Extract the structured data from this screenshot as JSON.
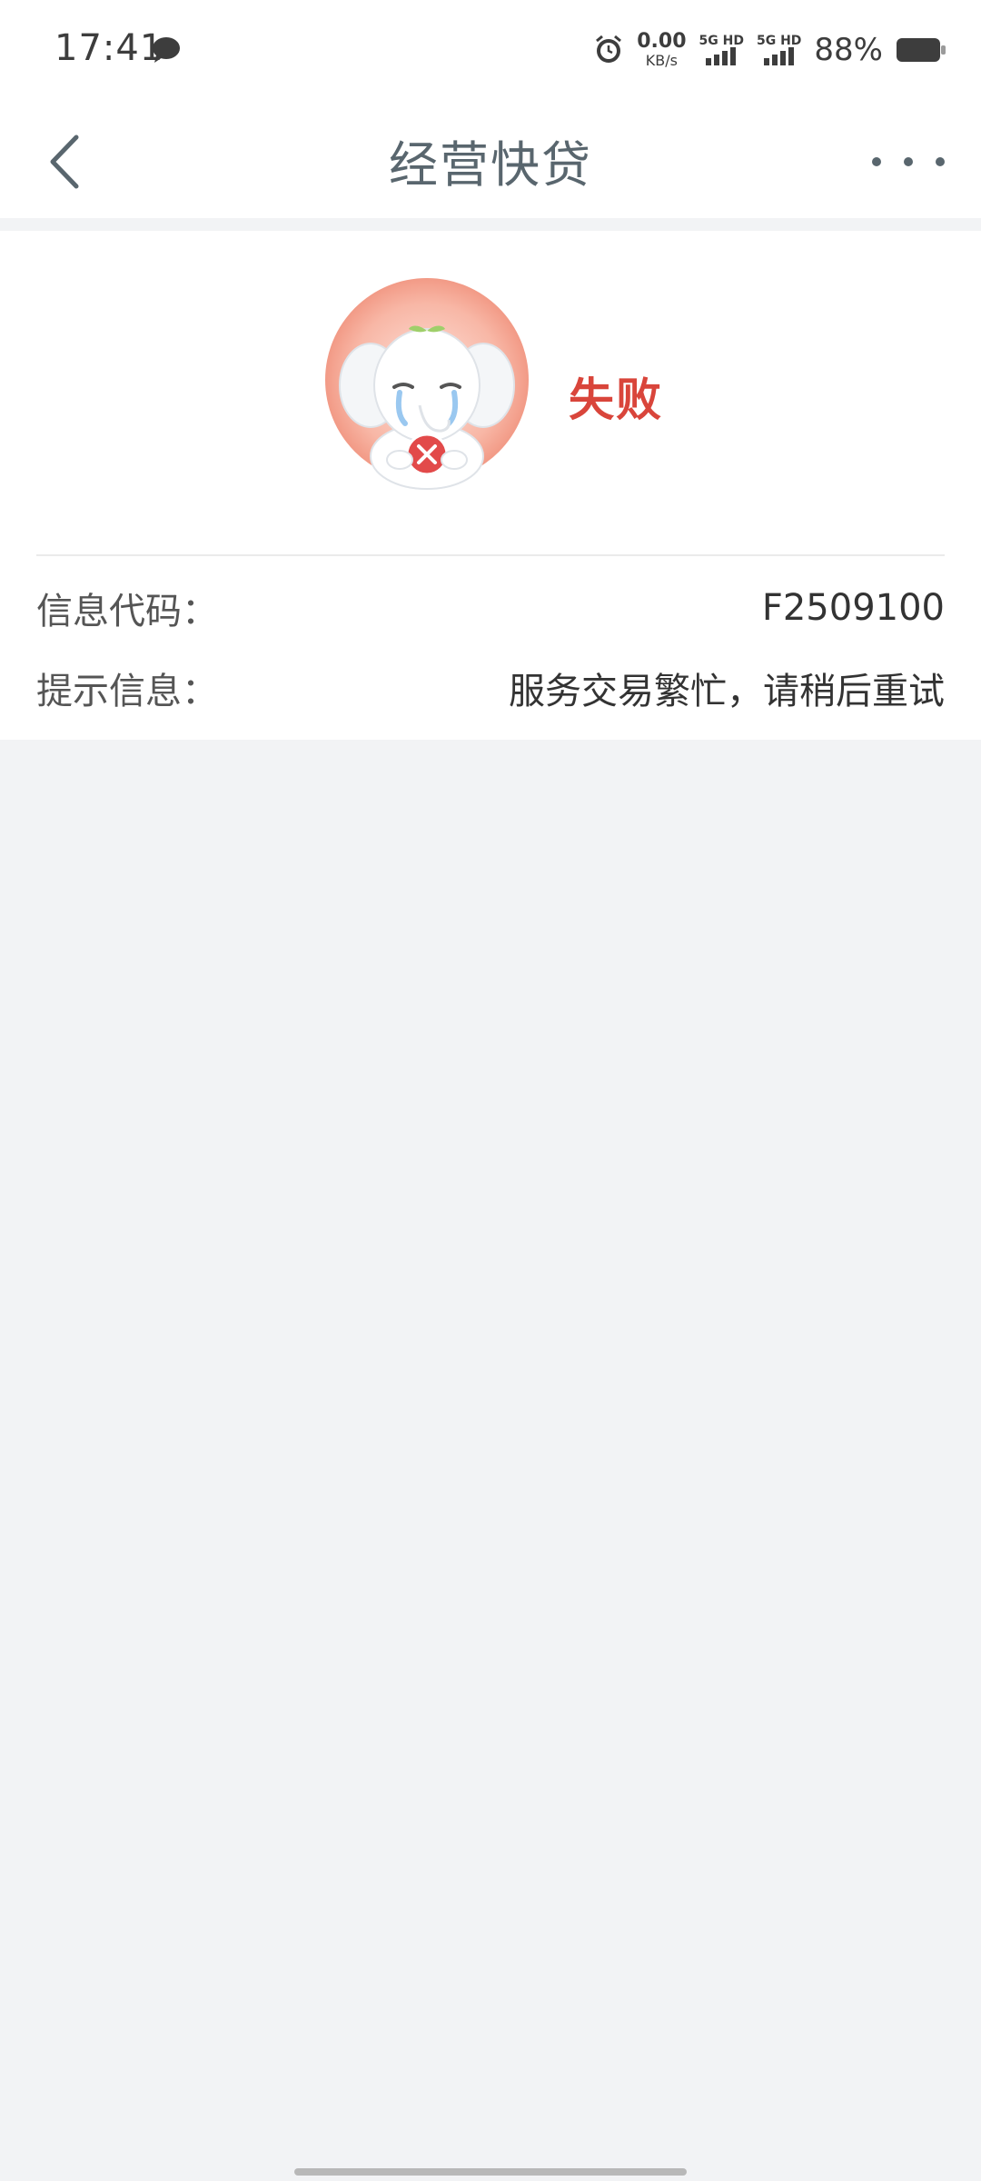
{
  "status_bar": {
    "time": "17:41",
    "net_speed_value": "0.00",
    "net_speed_unit": "KB/s",
    "sim1_label": "5G HD",
    "sim2_label": "5G HD",
    "battery_percent": "88%"
  },
  "nav": {
    "title": "经营快贷",
    "back_icon": "chevron-left-icon",
    "more_icon": "more-horizontal-icon"
  },
  "result": {
    "status_text": "失败",
    "status_color": "#d9453b",
    "illustration": "crying-elephant-icon"
  },
  "info": {
    "code_label": "信息代码：",
    "code_value": "F2509100",
    "message_label": "提示信息：",
    "message_value": "服务交易繁忙，请稍后重试"
  }
}
